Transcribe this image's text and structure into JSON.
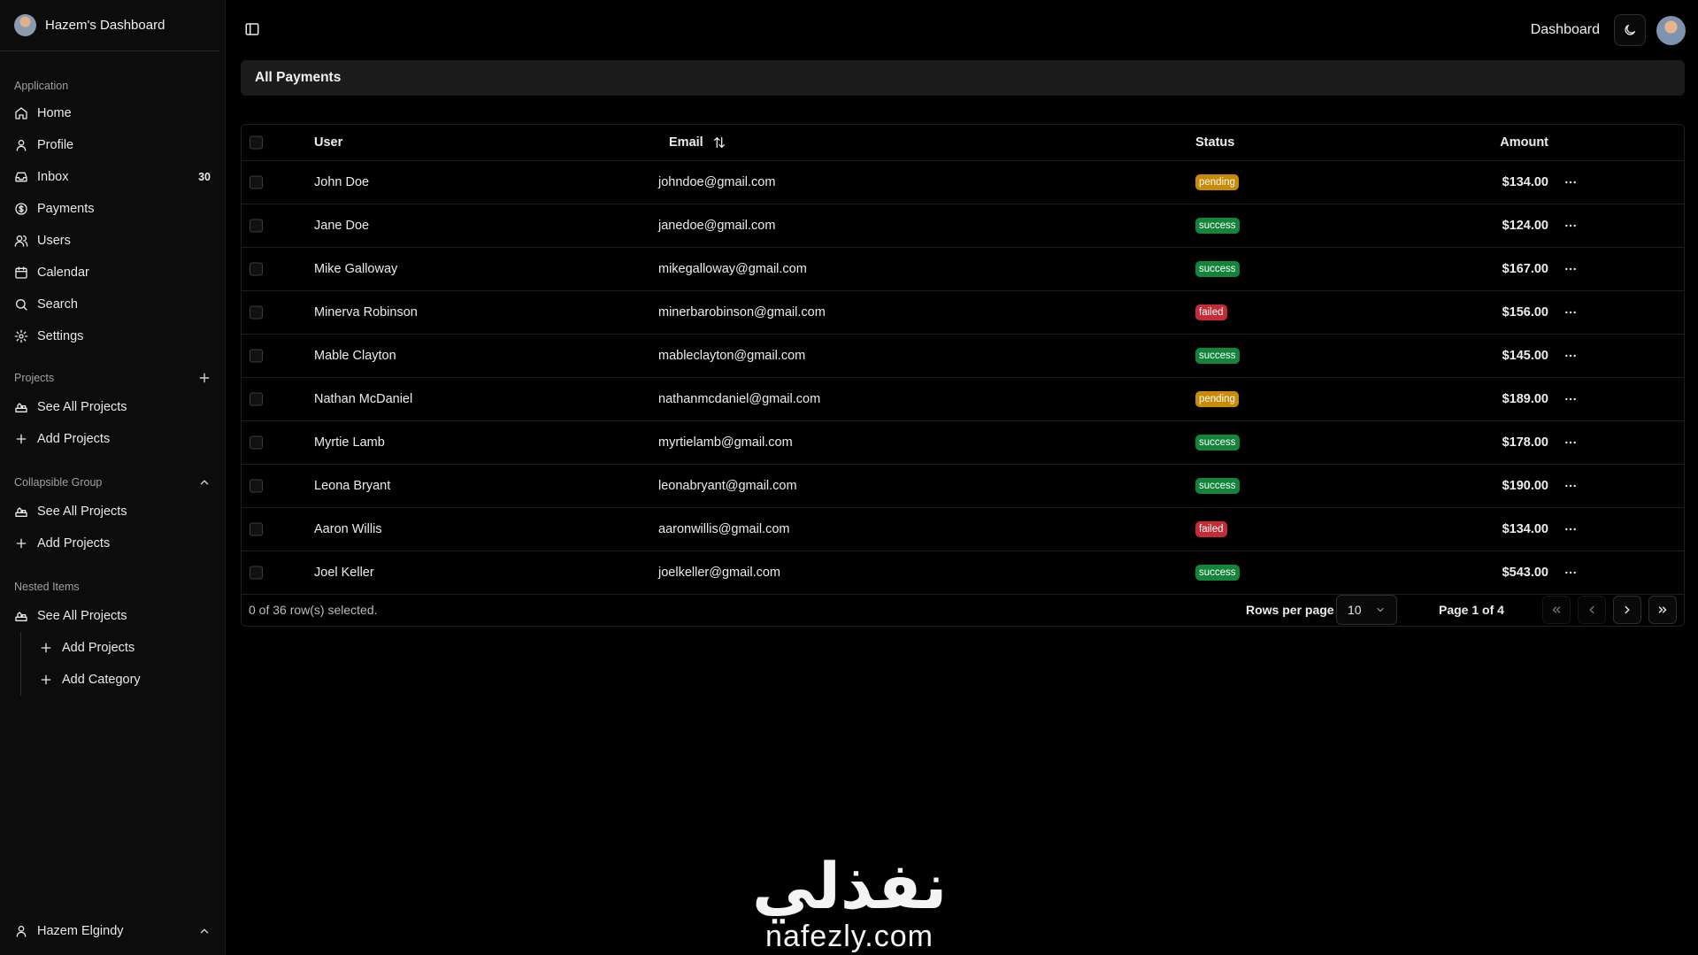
{
  "sidebar": {
    "title": "Hazem's Dashboard",
    "application_label": "Application",
    "items": [
      {
        "label": "Home",
        "icon": "home-icon"
      },
      {
        "label": "Profile",
        "icon": "user-icon"
      },
      {
        "label": "Inbox",
        "icon": "inbox-icon",
        "badge": "30"
      },
      {
        "label": "Payments",
        "icon": "dollar-icon"
      },
      {
        "label": "Users",
        "icon": "users-icon"
      },
      {
        "label": "Calendar",
        "icon": "calendar-icon"
      },
      {
        "label": "Search",
        "icon": "search-icon"
      },
      {
        "label": "Settings",
        "icon": "gear-icon"
      }
    ],
    "projects_label": "Projects",
    "projects_items": [
      {
        "label": "See All Projects",
        "icon": "projects-icon"
      },
      {
        "label": "Add Projects",
        "icon": "plus-icon"
      }
    ],
    "collapsible_label": "Collapsible Group",
    "collapsible_items": [
      {
        "label": "See All Projects",
        "icon": "projects-icon"
      },
      {
        "label": "Add Projects",
        "icon": "plus-icon"
      }
    ],
    "nested_label": "Nested Items",
    "nested_parent": {
      "label": "See All Projects",
      "icon": "projects-icon"
    },
    "nested_children": [
      {
        "label": "Add Projects",
        "icon": "plus-icon"
      },
      {
        "label": "Add Category",
        "icon": "plus-icon"
      }
    ],
    "footer_user": "Hazem Elgindy"
  },
  "topbar": {
    "breadcrumb": "Dashboard",
    "theme_icon": "moon-icon"
  },
  "page": {
    "title": "All Payments"
  },
  "table": {
    "columns": {
      "user": "User",
      "email": "Email",
      "status": "Status",
      "amount": "Amount"
    },
    "rows": [
      {
        "user": "John Doe",
        "email": "johndoe@gmail.com",
        "status": "pending",
        "amount": "$134.00"
      },
      {
        "user": "Jane Doe",
        "email": "janedoe@gmail.com",
        "status": "success",
        "amount": "$124.00"
      },
      {
        "user": "Mike Galloway",
        "email": "mikegalloway@gmail.com",
        "status": "success",
        "amount": "$167.00"
      },
      {
        "user": "Minerva Robinson",
        "email": "minerbarobinson@gmail.com",
        "status": "failed",
        "amount": "$156.00"
      },
      {
        "user": "Mable Clayton",
        "email": "mableclayton@gmail.com",
        "status": "success",
        "amount": "$145.00"
      },
      {
        "user": "Nathan McDaniel",
        "email": "nathanmcdaniel@gmail.com",
        "status": "pending",
        "amount": "$189.00"
      },
      {
        "user": "Myrtie Lamb",
        "email": "myrtielamb@gmail.com",
        "status": "success",
        "amount": "$178.00"
      },
      {
        "user": "Leona Bryant",
        "email": "leonabryant@gmail.com",
        "status": "success",
        "amount": "$190.00"
      },
      {
        "user": "Aaron Willis",
        "email": "aaronwillis@gmail.com",
        "status": "failed",
        "amount": "$134.00"
      },
      {
        "user": "Joel Keller",
        "email": "joelkeller@gmail.com",
        "status": "success",
        "amount": "$543.00"
      }
    ],
    "selection_text": "0 of 36 row(s) selected.",
    "rows_per_page_label": "Rows per page",
    "rows_per_page_value": "10",
    "page_info": "Page 1 of 4"
  },
  "watermark": {
    "arabic": "نفذلي",
    "latin": "nafezly.com"
  },
  "colors": {
    "success": "#13843a",
    "pending": "#c98a07",
    "failed": "#c42b36",
    "background": "#000000",
    "sidebar": "#0c0c0c"
  }
}
